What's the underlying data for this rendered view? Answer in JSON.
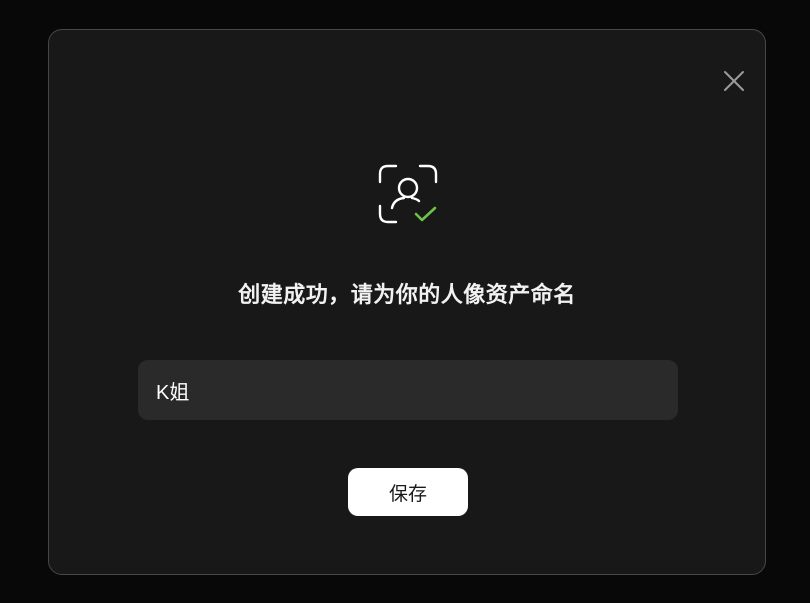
{
  "dialog": {
    "close_icon": "close-icon",
    "status_icon": "face-id-check-icon",
    "status_icon_check_color": "#6cc24a",
    "title": "创建成功，请为你的人像资产命名",
    "name_input": {
      "value": "K姐",
      "placeholder": ""
    },
    "save_label": "保存"
  }
}
